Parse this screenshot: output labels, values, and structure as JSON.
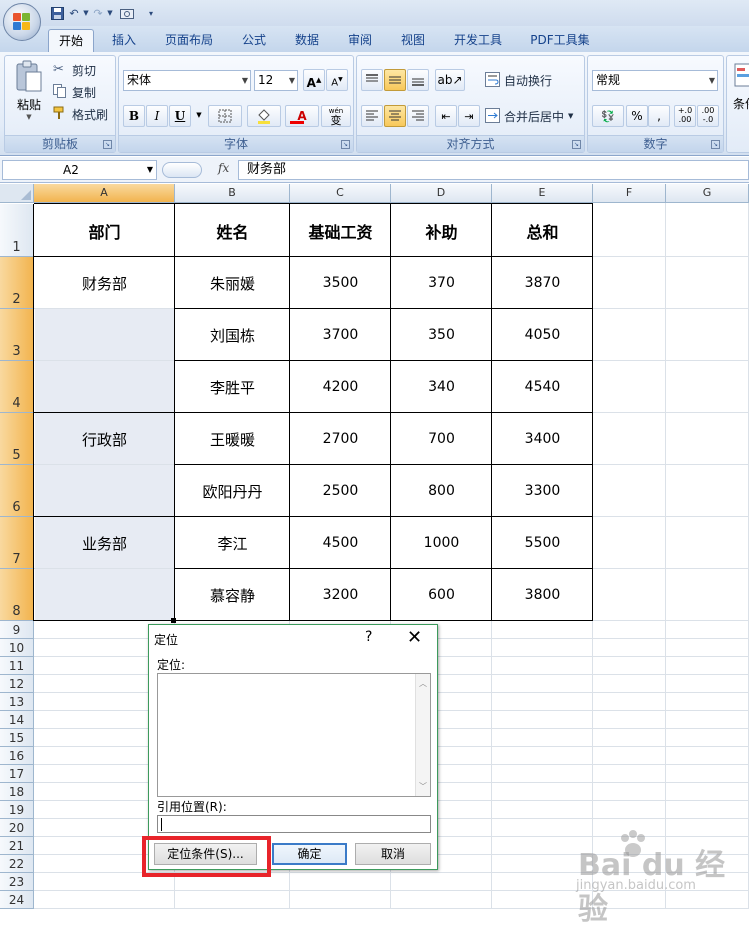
{
  "ribbon": {
    "tabs": [
      "开始",
      "插入",
      "页面布局",
      "公式",
      "数据",
      "审阅",
      "视图",
      "开发工具",
      "PDF工具集"
    ],
    "clipboard": {
      "paste": "粘贴",
      "cut": "剪切",
      "copy": "复制",
      "format_painter": "格式刷",
      "label": "剪贴板"
    },
    "font": {
      "name": "宋体",
      "size": "12",
      "bold": "B",
      "italic": "I",
      "underline": "U",
      "font_color": "A",
      "grow": "A",
      "shrink": "A",
      "wen": "wén",
      "bian": "变",
      "label": "字体"
    },
    "alignment": {
      "wrap": "自动换行",
      "merge": "合并后居中",
      "label": "对齐方式"
    },
    "number": {
      "format": "常规",
      "percent": "%",
      "comma": ",",
      "inc_decimal": ".00",
      "dec_decimal": ".00",
      "inc_small": "+.0",
      "dec_small": "-.0",
      "label": "数字"
    },
    "styles": {
      "cond": "条件"
    }
  },
  "formula_bar": {
    "cell_ref": "A2",
    "fx": "fx",
    "content": "财务部"
  },
  "sheet": {
    "columns": [
      "A",
      "B",
      "C",
      "D",
      "E",
      "F",
      "G"
    ],
    "rows": [
      "1",
      "2",
      "3",
      "4",
      "5",
      "6",
      "7",
      "8",
      "9",
      "10",
      "11",
      "12",
      "13",
      "14",
      "15",
      "16",
      "17",
      "18",
      "19",
      "20",
      "21",
      "22",
      "23",
      "24"
    ],
    "headers": [
      "部门",
      "姓名",
      "基础工资",
      "补助",
      "总和"
    ],
    "departments": [
      "财务部",
      "行政部",
      "业务部"
    ],
    "records": [
      {
        "name": "朱丽媛",
        "base": "3500",
        "allowance": "370",
        "total": "3870"
      },
      {
        "name": "刘国栋",
        "base": "3700",
        "allowance": "350",
        "total": "4050"
      },
      {
        "name": "李胜平",
        "base": "4200",
        "allowance": "340",
        "total": "4540"
      },
      {
        "name": "王暖暖",
        "base": "2700",
        "allowance": "700",
        "total": "3400"
      },
      {
        "name": "欧阳丹丹",
        "base": "2500",
        "allowance": "800",
        "total": "3300"
      },
      {
        "name": "李江",
        "base": "4500",
        "allowance": "1000",
        "total": "5500"
      },
      {
        "name": "慕容静",
        "base": "3200",
        "allowance": "600",
        "total": "3800"
      }
    ]
  },
  "dialog": {
    "title": "定位",
    "help": "?",
    "close": "✕",
    "goto_label": "定位:",
    "ref_label": "引用位置(R):",
    "special_button": "定位条件(S)...",
    "ok_button": "确定",
    "cancel_button": "取消"
  },
  "watermark": {
    "brand": "Bai du 经验",
    "url": "jingyan.baidu.com"
  },
  "colors": {
    "accent": "#f2b44f",
    "highlight_box": "#e8242a",
    "dialog_border": "#3c9a5c"
  }
}
